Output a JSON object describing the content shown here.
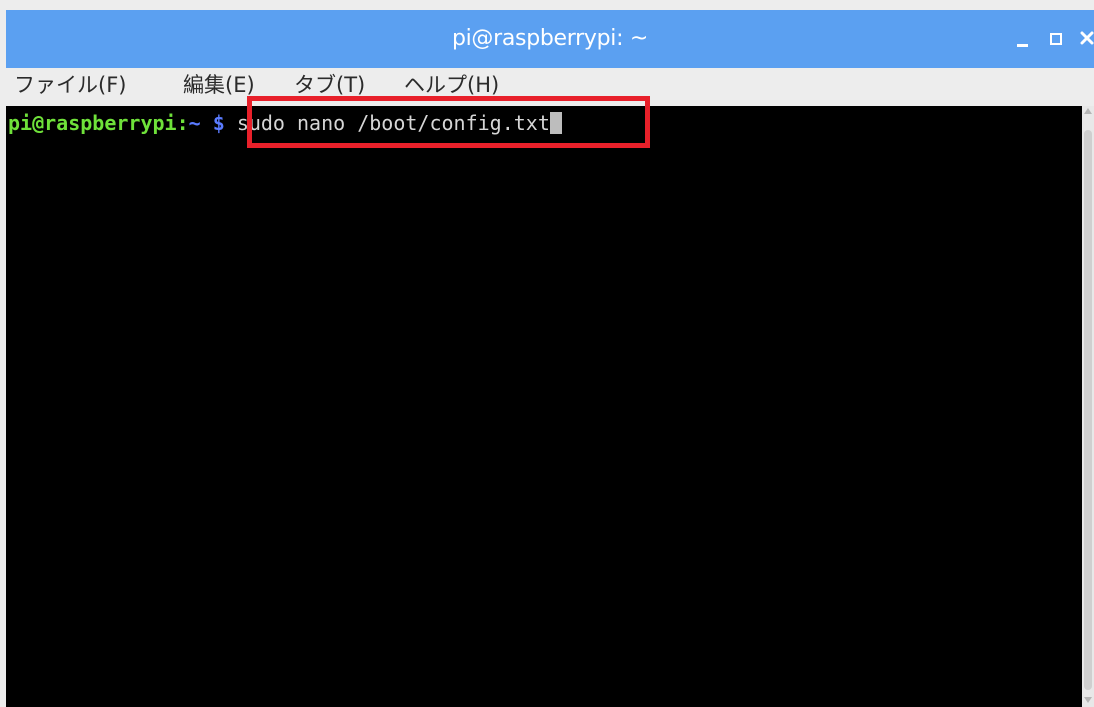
{
  "window": {
    "title": "pi@raspberrypi: ~"
  },
  "menu": {
    "items": [
      {
        "label": "ファイル(F)"
      },
      {
        "label": "編集(E)"
      },
      {
        "label": "タブ(T)"
      },
      {
        "label": "ヘルプ(H)"
      }
    ]
  },
  "terminal": {
    "prompt_user": "pi@raspberrypi",
    "prompt_sep": ":",
    "prompt_path": "~",
    "prompt_symbol": "$",
    "command": "sudo nano /boot/config.txt"
  },
  "colors": {
    "titlebar": "#5ba0f1",
    "terminal_bg": "#000000",
    "prompt_user": "#6fe13a",
    "prompt_path": "#5a7bff",
    "highlight": "#e8202a"
  },
  "icons": {
    "minimize": "minimize-icon",
    "maximize": "maximize-icon",
    "close": "close-icon"
  }
}
